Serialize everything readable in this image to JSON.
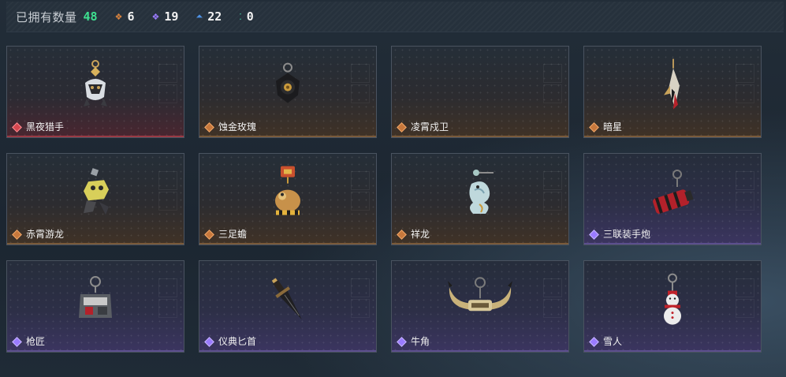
{
  "header": {
    "owned_label": "已拥有数量",
    "owned_count": "48",
    "stats": [
      {
        "icon": "orange-diamond-icon",
        "color": "#d9833e",
        "value": "6"
      },
      {
        "icon": "purple-diamond-icon",
        "color": "#9a7bff",
        "value": "19"
      },
      {
        "icon": "blue-chevron-icon",
        "color": "#4f93e6",
        "value": "22"
      },
      {
        "icon": "green-dots-icon",
        "color": "#3ecfa0",
        "value": "0"
      }
    ]
  },
  "items": [
    {
      "name": "黑夜猎手",
      "rarity": "red"
    },
    {
      "name": "蚀金玫瑰",
      "rarity": "orange"
    },
    {
      "name": "凌霄戍卫",
      "rarity": "orange"
    },
    {
      "name": "暗星",
      "rarity": "orange"
    },
    {
      "name": "赤霄游龙",
      "rarity": "orange"
    },
    {
      "name": "三足蟾",
      "rarity": "orange"
    },
    {
      "name": "祥龙",
      "rarity": "orange"
    },
    {
      "name": "三联装手炮",
      "rarity": "purple"
    },
    {
      "name": "枪匠",
      "rarity": "purple"
    },
    {
      "name": "仪典匕首",
      "rarity": "purple"
    },
    {
      "name": "牛角",
      "rarity": "purple"
    },
    {
      "name": "雪人",
      "rarity": "purple"
    }
  ]
}
